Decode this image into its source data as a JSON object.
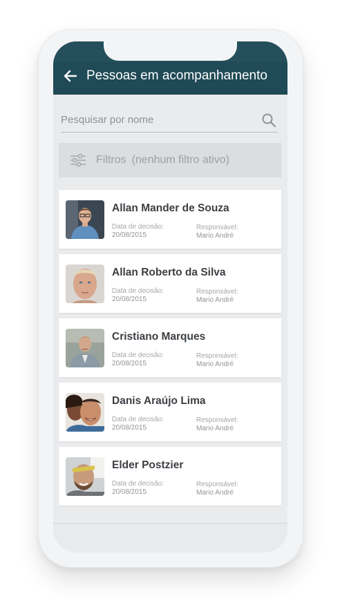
{
  "header": {
    "title": "Pessoas em acompanhamento",
    "back_icon": "arrow-left-icon"
  },
  "search": {
    "placeholder": "Pesquisar por nome",
    "value": "",
    "icon": "search-icon"
  },
  "filters": {
    "label": "Filtros",
    "status": "(nenhum filtro ativo)",
    "icon": "sliders-icon"
  },
  "people": [
    {
      "name": "Allan Mander de Souza",
      "date_label": "Data de decisão:",
      "date": "20/08/2015",
      "responsible_label": "Responsável:",
      "responsible": "Mario André"
    },
    {
      "name": "Allan Roberto da Silva",
      "date_label": "Data de decisão:",
      "date": "20/08/2015",
      "responsible_label": "Responsável:",
      "responsible": "Mario André"
    },
    {
      "name": "Cristiano Marques",
      "date_label": "Data de decisão:",
      "date": "20/08/2015",
      "responsible_label": "Responsável:",
      "responsible": "Mario André"
    },
    {
      "name": "Danis Araújo Lima",
      "date_label": "Data de decisão:",
      "date": "20/08/2015",
      "responsible_label": "Responsável:",
      "responsible": "Mario André"
    },
    {
      "name": "Elder Postzier",
      "date_label": "Data de decisão:",
      "date": "20/08/2015",
      "responsible_label": "Responsável:",
      "responsible": "Mario André"
    }
  ],
  "colors": {
    "header": "#1f4a56",
    "background": "#eaebed",
    "card": "#ffffff"
  }
}
